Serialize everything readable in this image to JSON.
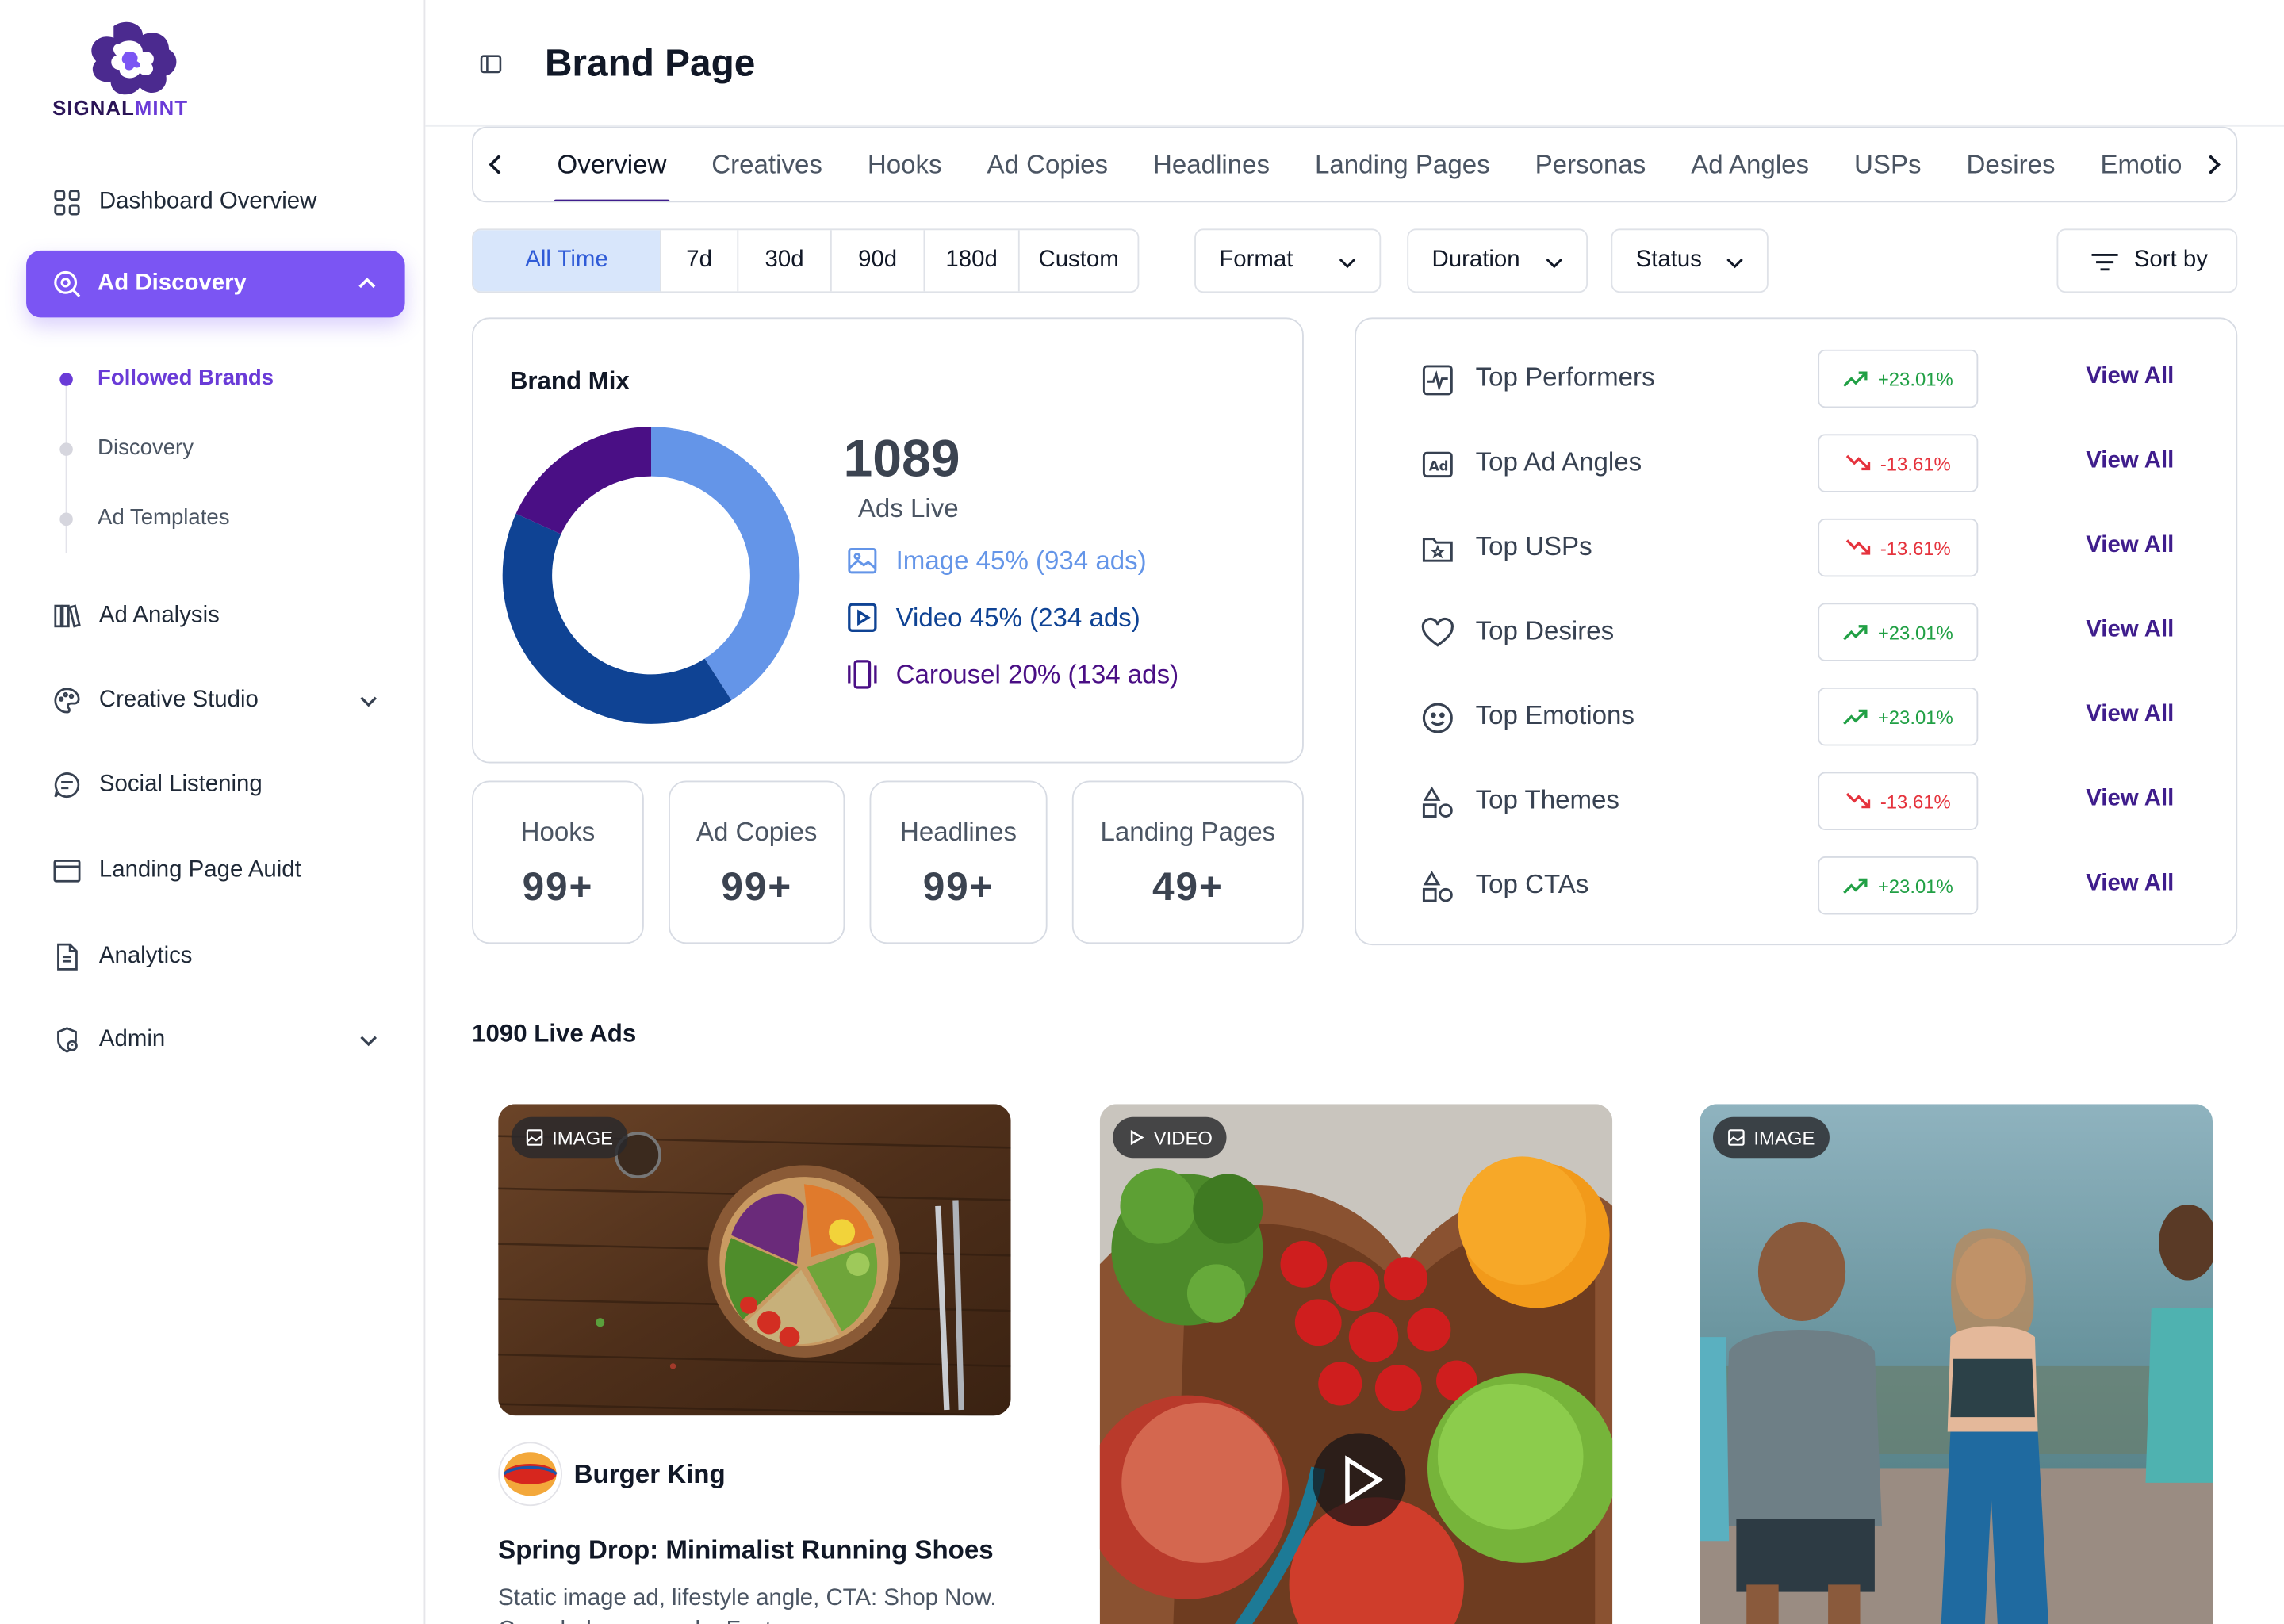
{
  "app": {
    "brand_left": "SIGNAL",
    "brand_right": "MINT"
  },
  "sidebar": {
    "dashboard": "Dashboard Overview",
    "ad_discovery": "Ad Discovery",
    "sub_items": [
      "Followed Brands",
      "Discovery",
      "Ad Templates"
    ],
    "ad_analysis": "Ad Analysis",
    "creative_studio": "Creative Studio",
    "social_listening": "Social Listening",
    "landing_audit": "Landing Page Auidt",
    "analytics": "Analytics",
    "admin": "Admin"
  },
  "header": {
    "title": "Brand Page"
  },
  "tabs": [
    "Overview",
    "Creatives",
    "Hooks",
    "Ad Copies",
    "Headlines",
    "Landing Pages",
    "Personas",
    "Ad Angles",
    "USPs",
    "Desires",
    "Emotio"
  ],
  "filters": {
    "time": [
      "All Time",
      "7d",
      "30d",
      "90d",
      "180d",
      "Custom"
    ],
    "format": "Format",
    "duration": "Duration",
    "status": "Status",
    "sort": "Sort by"
  },
  "brand_mix": {
    "title": "Brand Mix",
    "count": "1089",
    "count_label": "Ads Live",
    "rows": {
      "image": "Image 45% (934 ads)",
      "video": "Video 45% (234 ads)",
      "carousel": "Carousel 20% (134 ads)"
    },
    "colors": {
      "image": "#6495e8",
      "video": "#0f4394",
      "carousel": "#4a0f85"
    },
    "chart_data": {
      "type": "pie",
      "categories": [
        "Image",
        "Video",
        "Carousel"
      ],
      "values": [
        45,
        45,
        20
      ]
    }
  },
  "stats": [
    {
      "label": "Hooks",
      "value": "99+"
    },
    {
      "label": "Ad Copies",
      "value": "99+"
    },
    {
      "label": "Headlines",
      "value": "99+"
    },
    {
      "label": "Landing Pages",
      "value": "49+"
    }
  ],
  "tops": [
    {
      "label": "Top Performers",
      "change": "+23.01%",
      "dir": "up",
      "action": "View All"
    },
    {
      "label": "Top Ad Angles",
      "change": "-13.61%",
      "dir": "down",
      "action": "View All"
    },
    {
      "label": "Top USPs",
      "change": "-13.61%",
      "dir": "down",
      "action": "View All"
    },
    {
      "label": "Top Desires",
      "change": "+23.01%",
      "dir": "up",
      "action": "View All"
    },
    {
      "label": "Top Emotions",
      "change": "+23.01%",
      "dir": "up",
      "action": "View All"
    },
    {
      "label": "Top Themes",
      "change": "-13.61%",
      "dir": "down",
      "action": "View All"
    },
    {
      "label": "Top CTAs",
      "change": "+23.01%",
      "dir": "up",
      "action": "View All"
    }
  ],
  "live_ads": {
    "title": "1090 Live Ads",
    "cards": [
      {
        "type": "IMAGE",
        "brand": "Burger King",
        "title": "Spring Drop: Minimalist  Running Shoes",
        "desc": "Static image ad, lifestyle angle, CTA: Shop Now. Crowd-pleaser angle. Fast"
      },
      {
        "type": "VIDEO"
      },
      {
        "type": "IMAGE"
      }
    ],
    "logo_text": "BURGER KING"
  }
}
